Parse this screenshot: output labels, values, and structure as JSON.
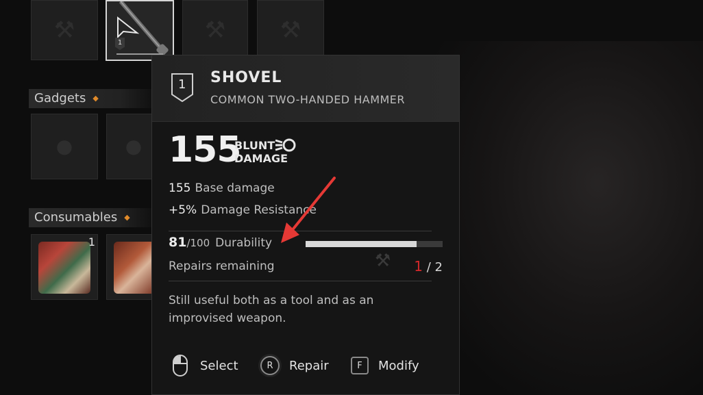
{
  "inventory": {
    "weapon_slot_badge": "1",
    "sections": {
      "gadgets": "Gadgets",
      "consumables": "Consumables"
    },
    "consumables": [
      {
        "qty": "1"
      },
      {
        "qty": ""
      }
    ]
  },
  "tooltip": {
    "tier": "1",
    "name": "SHOVEL",
    "type": "COMMON TWO-HANDED HAMMER",
    "damage_value": "155",
    "damage_type_line1": "BLUNT",
    "damage_type_line2": "DAMAGE",
    "stats": [
      {
        "value": "155",
        "label": "Base damage"
      },
      {
        "value": "+5%",
        "label": "Damage Resistance"
      }
    ],
    "durability": {
      "current": "81",
      "max": "/100",
      "label": "Durability",
      "fraction": 0.81
    },
    "repairs": {
      "label": "Repairs remaining",
      "remaining": "1",
      "total": " / 2"
    },
    "description": "Still useful both as a tool and as an improvised weapon.",
    "actions": [
      {
        "key": "",
        "label": "Select",
        "icon": "mouse-icon"
      },
      {
        "key": "R",
        "label": "Repair",
        "icon": "key-r"
      },
      {
        "key": "F",
        "label": "Modify",
        "icon": "key-f"
      }
    ]
  },
  "colors": {
    "accent_orange": "#e08a2a",
    "repairs_red": "#d4282b",
    "annotation_arrow": "#e53935"
  }
}
